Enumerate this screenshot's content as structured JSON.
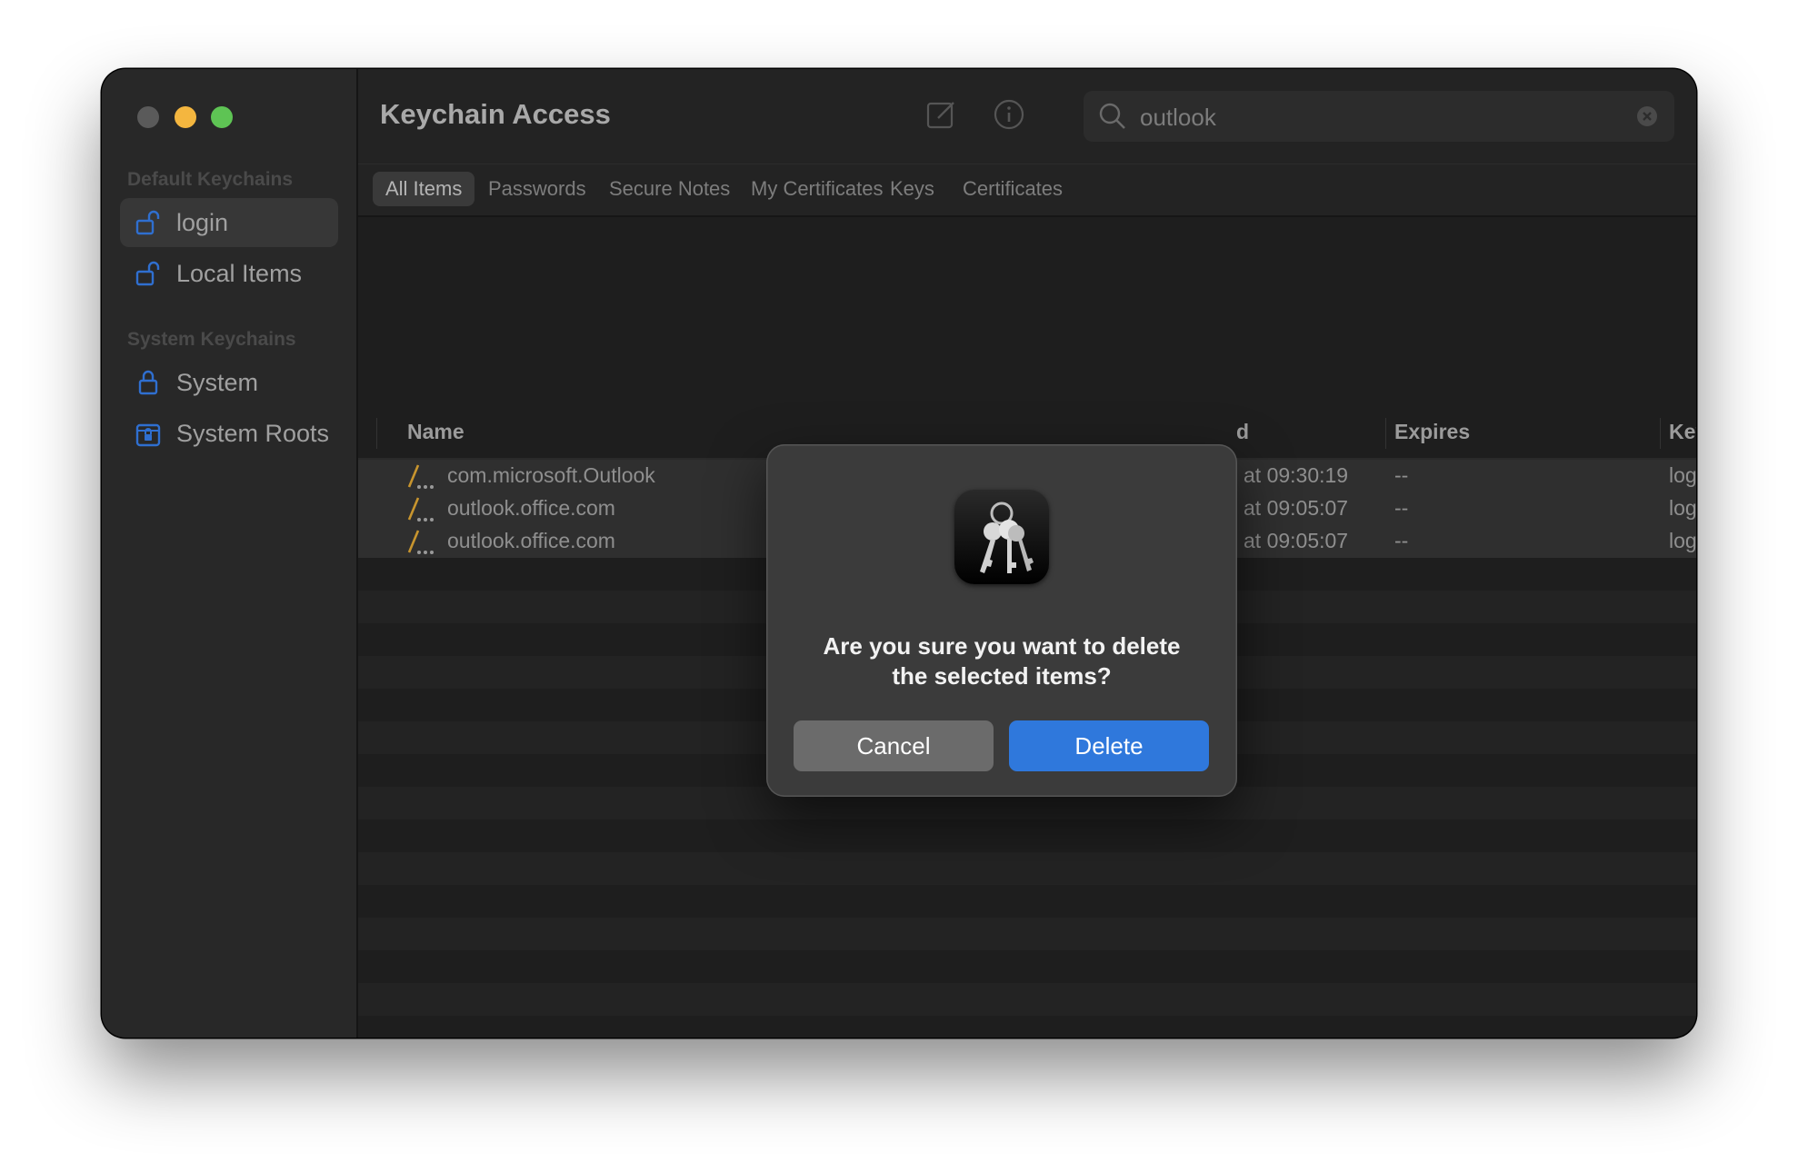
{
  "window": {
    "title": "Keychain Access",
    "search": {
      "value": "outlook",
      "placeholder": "Search"
    }
  },
  "sidebar": {
    "default_title": "Default Keychains",
    "system_title": "System Keychains",
    "items": [
      {
        "label": "login",
        "icon": "unlocked-padlock-icon",
        "selected": true
      },
      {
        "label": "Local Items",
        "icon": "unlocked-padlock-icon",
        "selected": false
      },
      {
        "label": "System",
        "icon": "locked-padlock-icon",
        "selected": false
      },
      {
        "label": "System Roots",
        "icon": "locked-cabinet-icon",
        "selected": false
      }
    ]
  },
  "tabs": [
    "All Items",
    "Passwords",
    "Secure Notes",
    "My Certificates",
    "Keys",
    "Certificates"
  ],
  "columns": {
    "name": "Name",
    "modified": "d",
    "expires": "Expires",
    "keychain": "Keychain"
  },
  "rows": [
    {
      "name": "com.microsoft.Outlook",
      "modified": "at 09:30:19",
      "expires": "--",
      "keychain": "login"
    },
    {
      "name": "outlook.office.com",
      "modified": "at 09:05:07",
      "expires": "--",
      "keychain": "login"
    },
    {
      "name": "outlook.office.com",
      "modified": "at 09:05:07",
      "expires": "--",
      "keychain": "login"
    }
  ],
  "dialog": {
    "message_line1": "Are you sure you want to delete",
    "message_line2": "the selected items?",
    "cancel_label": "Cancel",
    "delete_label": "Delete",
    "icon": "keychain-app-icon"
  },
  "colors": {
    "accent": "#2f78dc",
    "sidebar_icon": "#2f6fd0",
    "password_icon": "#c8952e"
  }
}
